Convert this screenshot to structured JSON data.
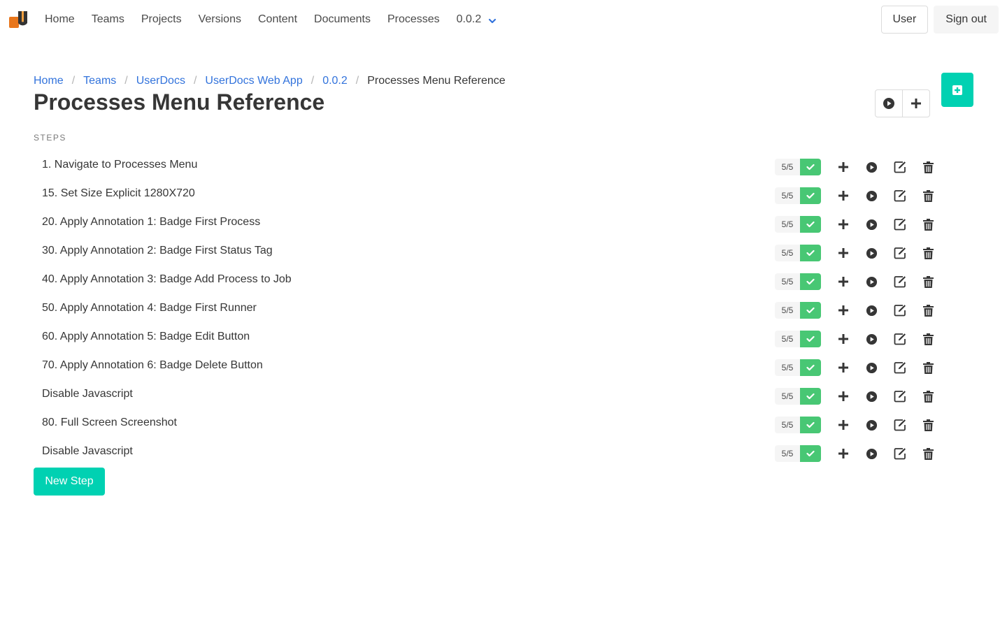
{
  "navbar": {
    "logo_icon": "userdocs-logo-icon",
    "links": [
      "Home",
      "Teams",
      "Projects",
      "Versions",
      "Content",
      "Documents",
      "Processes"
    ],
    "version": "0.0.2",
    "user_label": "User",
    "signout_label": "Sign out"
  },
  "breadcrumb": {
    "links": [
      "Home",
      "Teams",
      "UserDocs",
      "UserDocs Web App",
      "0.0.2"
    ],
    "separator": "/",
    "current": "Processes Menu Reference"
  },
  "page": {
    "title": "Processes Menu Reference",
    "steps_label": "STEPS",
    "new_step_label": "New Step"
  },
  "colors": {
    "accent": "#00d1b2",
    "link": "#3273dc",
    "success": "#48c774"
  },
  "steps": [
    {
      "name": "1. Navigate to Processes Menu",
      "count": "5/5"
    },
    {
      "name": "15. Set Size Explicit 1280X720",
      "count": "5/5"
    },
    {
      "name": "20. Apply Annotation 1: Badge First Process",
      "count": "5/5"
    },
    {
      "name": "30. Apply Annotation 2: Badge First Status Tag",
      "count": "5/5"
    },
    {
      "name": "40. Apply Annotation 3: Badge Add Process to Job",
      "count": "5/5"
    },
    {
      "name": "50. Apply Annotation 4: Badge First Runner",
      "count": "5/5"
    },
    {
      "name": "60. Apply Annotation 5: Badge Edit Button",
      "count": "5/5"
    },
    {
      "name": "70. Apply Annotation 6: Badge Delete Button",
      "count": "5/5"
    },
    {
      "name": "Disable Javascript",
      "count": "5/5"
    },
    {
      "name": "80. Full Screen Screenshot",
      "count": "5/5"
    },
    {
      "name": "Disable Javascript",
      "count": "5/5"
    }
  ]
}
